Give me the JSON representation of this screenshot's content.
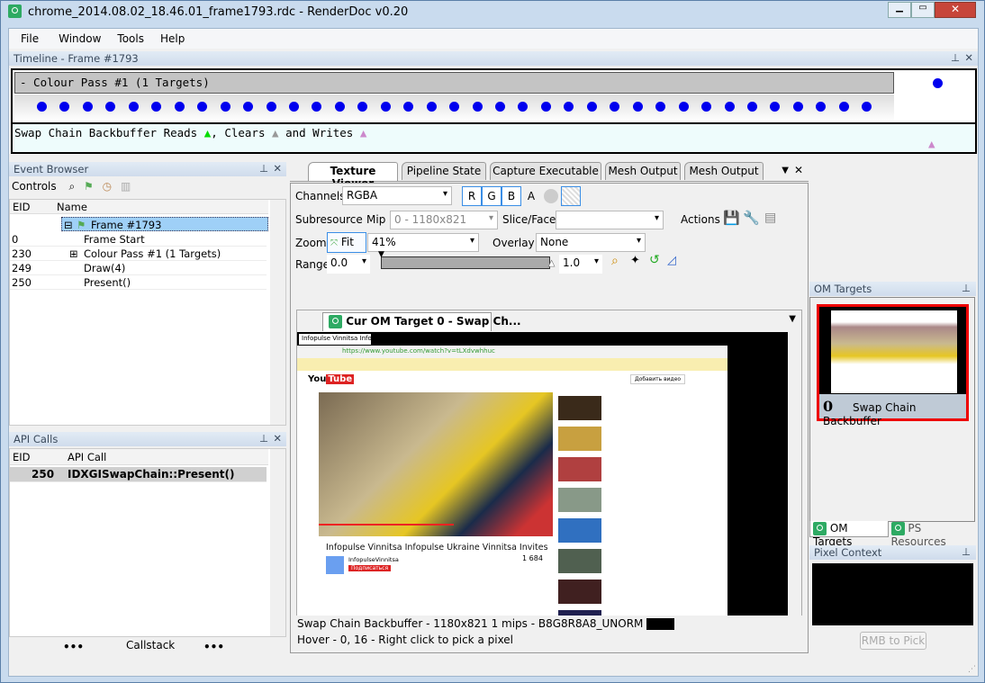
{
  "window": {
    "title": "chrome_2014.08.02_18.46.01_frame1793.rdc - RenderDoc v0.20"
  },
  "menu": [
    "File",
    "Window",
    "Tools",
    "Help"
  ],
  "timeline": {
    "title": "Timeline - Frame #1793",
    "pass_label": "- Colour Pass #1 (1 Targets)",
    "dot_count": 37,
    "legend": {
      "prefix": "Swap Chain Backbuffer Reads",
      "clears": ", Clears",
      "writes": "and Writes"
    },
    "colors": {
      "reads": "#00dd00",
      "clears": "#a0a0a0",
      "writes": "#cc88cc",
      "dots": "#0000ee"
    }
  },
  "event_browser": {
    "title": "Event Browser",
    "controls_label": "Controls",
    "columns": [
      "EID",
      "Name"
    ],
    "rows": [
      {
        "eid": "",
        "name": "Frame #1793",
        "selected": true
      },
      {
        "eid": "0",
        "name": "Frame Start"
      },
      {
        "eid": "230",
        "name": "Colour Pass #1 (1 Targets)"
      },
      {
        "eid": "249",
        "name": "Draw(4)"
      },
      {
        "eid": "250",
        "name": "Present()"
      }
    ]
  },
  "api_calls": {
    "title": "API Calls",
    "columns": [
      "EID",
      "API Call"
    ],
    "rows": [
      {
        "eid": "250",
        "call": "IDXGISwapChain::Present()"
      }
    ]
  },
  "callstack": {
    "label": "Callstack"
  },
  "tabs": [
    "Texture Viewer",
    "Pipeline State",
    "Capture Executable",
    "Mesh Output",
    "Mesh Output"
  ],
  "texture_viewer": {
    "channels_label": "Channels",
    "channels_value": "RGBA",
    "channel_buttons": [
      "R",
      "G",
      "B",
      "A"
    ],
    "subresource_label": "Subresource",
    "mip_label": "Mip",
    "mip_value": "0 - 1180x821",
    "slice_label": "Slice/Face",
    "slice_value": "",
    "actions_label": "Actions",
    "zoom_label": "Zoom",
    "fit_label": "Fit",
    "zoom_value": "41%",
    "overlay_label": "Overlay",
    "overlay_value": "None",
    "range_label": "Range",
    "range_min": "0.0",
    "range_max": "1.0",
    "texture_tab": "Cur OM Target 0 - Swap Ch...",
    "status_line1": "Swap Chain Backbuffer - 1180x821 1 mips - B8G8R8A8_UNORM",
    "status_line2": "Hover - 0, 16 - Right click to pick a pixel",
    "pixel_swatch": "#000000"
  },
  "texture_content": {
    "tab_title": "Infopulse Vinnitsa Info",
    "url": "https://www.youtube.com/watch?v=tLXdvwhhuc",
    "video_title": "Infopulse Vinnitsa Infopulse Ukraine Vinnitsa Invites",
    "channel": "InfopulseVinnitsa",
    "views": "1 684",
    "subscribe": "Подписаться",
    "add_video": "Добавить видео"
  },
  "om_targets": {
    "title": "OM Targets",
    "thumb_index": "0",
    "thumb_label": "Swap Chain Backbuffer",
    "tabs": [
      "OM Targets",
      "PS Resources"
    ]
  },
  "pixel_context": {
    "title": "Pixel Context",
    "button": "RMB to Pick"
  }
}
